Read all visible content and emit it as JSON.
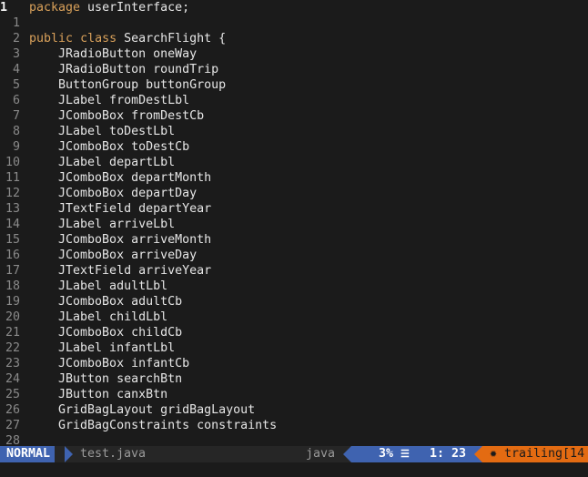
{
  "editor": {
    "current_line_number": "1",
    "lines": [
      {
        "num": "1",
        "tokens": [
          {
            "t": "package",
            "k": "kw"
          },
          {
            "t": " userInterface;",
            "k": "plain"
          }
        ]
      },
      {
        "num": "1",
        "tokens": []
      },
      {
        "num": "2",
        "tokens": [
          {
            "t": "public",
            "k": "kw"
          },
          {
            "t": " ",
            "k": "plain"
          },
          {
            "t": "class",
            "k": "kw"
          },
          {
            "t": " SearchFlight {",
            "k": "plain"
          }
        ]
      },
      {
        "num": "3",
        "tokens": [
          {
            "t": "    JRadioButton oneWay",
            "k": "plain"
          }
        ]
      },
      {
        "num": "4",
        "tokens": [
          {
            "t": "    JRadioButton roundTrip",
            "k": "plain"
          }
        ]
      },
      {
        "num": "5",
        "tokens": [
          {
            "t": "    ButtonGroup buttonGroup",
            "k": "plain"
          }
        ]
      },
      {
        "num": "6",
        "tokens": [
          {
            "t": "    JLabel fromDestLbl",
            "k": "plain"
          }
        ]
      },
      {
        "num": "7",
        "tokens": [
          {
            "t": "    JComboBox fromDestCb",
            "k": "plain"
          }
        ]
      },
      {
        "num": "8",
        "tokens": [
          {
            "t": "    JLabel toDestLbl",
            "k": "plain"
          }
        ]
      },
      {
        "num": "9",
        "tokens": [
          {
            "t": "    JComboBox toDestCb",
            "k": "plain"
          }
        ]
      },
      {
        "num": "10",
        "tokens": [
          {
            "t": "    JLabel departLbl",
            "k": "plain"
          }
        ]
      },
      {
        "num": "11",
        "tokens": [
          {
            "t": "    JComboBox departMonth",
            "k": "plain"
          }
        ]
      },
      {
        "num": "12",
        "tokens": [
          {
            "t": "    JComboBox departDay",
            "k": "plain"
          }
        ]
      },
      {
        "num": "13",
        "tokens": [
          {
            "t": "    JTextField departYear",
            "k": "plain"
          }
        ]
      },
      {
        "num": "14",
        "tokens": [
          {
            "t": "    JLabel arriveLbl",
            "k": "plain"
          }
        ]
      },
      {
        "num": "15",
        "tokens": [
          {
            "t": "    JComboBox arriveMonth",
            "k": "plain"
          }
        ]
      },
      {
        "num": "16",
        "tokens": [
          {
            "t": "    JComboBox arriveDay",
            "k": "plain"
          }
        ]
      },
      {
        "num": "17",
        "tokens": [
          {
            "t": "    JTextField arriveYear",
            "k": "plain"
          }
        ]
      },
      {
        "num": "18",
        "tokens": [
          {
            "t": "    JLabel adultLbl",
            "k": "plain"
          }
        ]
      },
      {
        "num": "19",
        "tokens": [
          {
            "t": "    JComboBox adultCb",
            "k": "plain"
          }
        ]
      },
      {
        "num": "20",
        "tokens": [
          {
            "t": "    JLabel childLbl",
            "k": "plain"
          }
        ]
      },
      {
        "num": "21",
        "tokens": [
          {
            "t": "    JComboBox childCb",
            "k": "plain"
          }
        ]
      },
      {
        "num": "22",
        "tokens": [
          {
            "t": "    JLabel infantLbl",
            "k": "plain"
          }
        ]
      },
      {
        "num": "23",
        "tokens": [
          {
            "t": "    JComboBox infantCb",
            "k": "plain"
          }
        ]
      },
      {
        "num": "24",
        "tokens": [
          {
            "t": "    JButton searchBtn",
            "k": "plain"
          }
        ]
      },
      {
        "num": "25",
        "tokens": [
          {
            "t": "    JButton canxBtn",
            "k": "plain"
          }
        ]
      },
      {
        "num": "26",
        "tokens": [
          {
            "t": "    GridBagLayout gridBagLayout",
            "k": "plain"
          }
        ]
      },
      {
        "num": "27",
        "tokens": [
          {
            "t": "    GridBagConstraints constraints",
            "k": "plain"
          }
        ]
      },
      {
        "num": "28",
        "tokens": []
      }
    ]
  },
  "statusline": {
    "mode": "NORMAL",
    "filename": "test.java",
    "filetype": "java",
    "percent": "3%",
    "line_icon": "ln-icon",
    "line_icon_glyph": "☰",
    "cursor_position": "1: 23",
    "warning": "✹ trailing[14"
  },
  "colors": {
    "background": "#1b1b1b",
    "keyword": "#d8a05a",
    "text": "#e6e6e6",
    "line_number": "#8a8a8a",
    "mode_bg": "#3f63b0",
    "warning_bg": "#e36b12"
  }
}
